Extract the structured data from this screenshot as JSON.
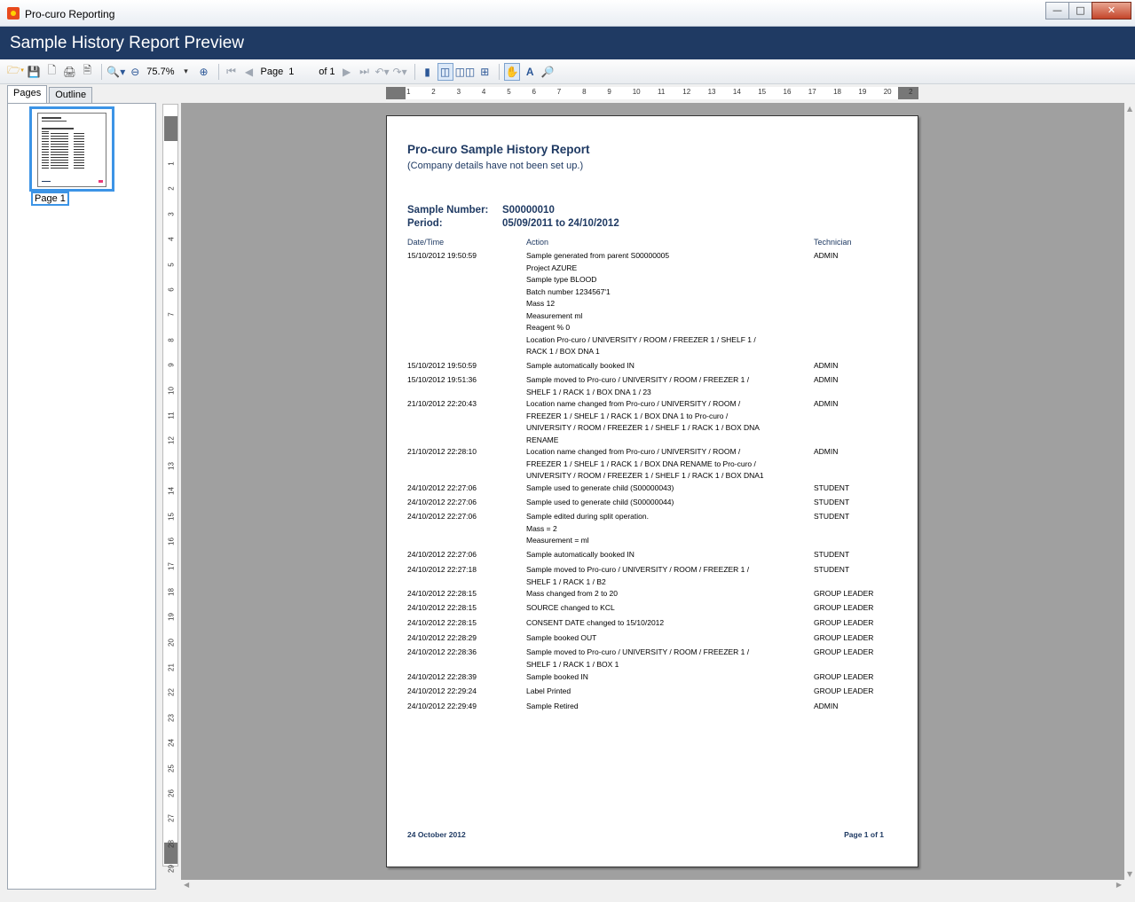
{
  "window": {
    "title": "Pro-curo Reporting"
  },
  "header": {
    "title": "Sample History Report Preview"
  },
  "toolbar": {
    "zoom": "75.7%",
    "page_label": "Page",
    "page_value": "1",
    "of_label": "of 1"
  },
  "tabs": [
    "Pages",
    "Outline"
  ],
  "thumbnail": {
    "label": "Page 1"
  },
  "ruler": {
    "h": [
      "1",
      "2",
      "3",
      "4",
      "5",
      "6",
      "7",
      "8",
      "9",
      "10",
      "11",
      "12",
      "13",
      "14",
      "15",
      "16",
      "17",
      "18",
      "19",
      "20",
      "2"
    ],
    "v": [
      "1",
      "2",
      "3",
      "4",
      "5",
      "6",
      "7",
      "8",
      "9",
      "10",
      "11",
      "12",
      "13",
      "14",
      "15",
      "16",
      "17",
      "18",
      "19",
      "20",
      "21",
      "22",
      "23",
      "24",
      "25",
      "26",
      "27",
      "28",
      "29"
    ]
  },
  "report": {
    "title": "Pro-curo Sample History Report",
    "subtitle": "(Company details have not been set up.)",
    "sample_number_label": "Sample Number:",
    "sample_number": "S00000010",
    "period_label": "Period:",
    "period": "05/09/2011 to 24/10/2012",
    "columns": {
      "datetime": "Date/Time",
      "action": "Action",
      "technician": "Technician"
    },
    "rows": [
      {
        "dt": "15/10/2012 19:50:59",
        "action": [
          "Sample generated from parent S00000005",
          "Project AZURE",
          "Sample type BLOOD",
          "Batch number 1234567'1",
          "Mass 12",
          "Measurement ml",
          "Reagent % 0",
          "Location Pro-curo / UNIVERSITY / ROOM / FREEZER 1 / SHELF 1 /",
          "RACK 1 / BOX DNA 1"
        ],
        "tech": "ADMIN"
      },
      {
        "dt": "15/10/2012 19:50:59",
        "action": [
          "Sample automatically booked IN"
        ],
        "tech": "ADMIN"
      },
      {
        "dt": "15/10/2012 19:51:36",
        "action": [
          "Sample moved to Pro-curo / UNIVERSITY / ROOM / FREEZER 1 /",
          "SHELF 1 / RACK 1 / BOX DNA 1 / 23"
        ],
        "tech": "ADMIN"
      },
      {
        "dt": "21/10/2012 22:20:43",
        "action": [
          "Location name changed from Pro-curo / UNIVERSITY / ROOM /",
          "FREEZER 1 / SHELF 1 / RACK 1 / BOX DNA 1 to Pro-curo /",
          "UNIVERSITY / ROOM / FREEZER 1 / SHELF 1 / RACK 1 / BOX DNA",
          "RENAME"
        ],
        "tech": "ADMIN"
      },
      {
        "dt": "21/10/2012 22:28:10",
        "action": [
          "Location name changed from Pro-curo / UNIVERSITY / ROOM /",
          "FREEZER 1 / SHELF 1 / RACK 1 / BOX DNA RENAME to Pro-curo /",
          "UNIVERSITY / ROOM / FREEZER 1 / SHELF 1 / RACK 1 / BOX DNA1"
        ],
        "tech": "ADMIN"
      },
      {
        "dt": "24/10/2012 22:27:06",
        "action": [
          "Sample used to generate child (S00000043)"
        ],
        "tech": "STUDENT"
      },
      {
        "dt": "24/10/2012 22:27:06",
        "action": [
          "Sample used to generate child (S00000044)"
        ],
        "tech": "STUDENT"
      },
      {
        "dt": "24/10/2012 22:27:06",
        "action": [
          "Sample edited during split operation.",
          "Mass = 2",
          "Measurement = ml"
        ],
        "tech": "STUDENT"
      },
      {
        "dt": "24/10/2012 22:27:06",
        "action": [
          "Sample automatically booked IN"
        ],
        "tech": "STUDENT"
      },
      {
        "dt": "24/10/2012 22:27:18",
        "action": [
          "Sample moved to Pro-curo / UNIVERSITY / ROOM / FREEZER 1 /",
          "SHELF 1 / RACK 1 / B2"
        ],
        "tech": "STUDENT"
      },
      {
        "dt": "24/10/2012 22:28:15",
        "action": [
          "Mass changed from 2 to 20"
        ],
        "tech": "GROUP LEADER"
      },
      {
        "dt": "24/10/2012 22:28:15",
        "action": [
          "SOURCE changed to KCL"
        ],
        "tech": "GROUP LEADER"
      },
      {
        "dt": "24/10/2012 22:28:15",
        "action": [
          "CONSENT DATE changed to 15/10/2012"
        ],
        "tech": "GROUP LEADER"
      },
      {
        "dt": "24/10/2012 22:28:29",
        "action": [
          "Sample booked OUT"
        ],
        "tech": "GROUP LEADER"
      },
      {
        "dt": "24/10/2012 22:28:36",
        "action": [
          "Sample moved to Pro-curo / UNIVERSITY / ROOM / FREEZER 1 /",
          "SHELF 1 / RACK 1 / BOX 1"
        ],
        "tech": "GROUP LEADER"
      },
      {
        "dt": "24/10/2012 22:28:39",
        "action": [
          "Sample booked IN"
        ],
        "tech": "GROUP LEADER"
      },
      {
        "dt": "24/10/2012 22:29:24",
        "action": [
          "Label Printed"
        ],
        "tech": "GROUP LEADER"
      },
      {
        "dt": "24/10/2012 22:29:49",
        "action": [
          "Sample Retired"
        ],
        "tech": "ADMIN"
      }
    ],
    "footer_date": "24 October 2012",
    "footer_page": "Page 1 of 1"
  }
}
